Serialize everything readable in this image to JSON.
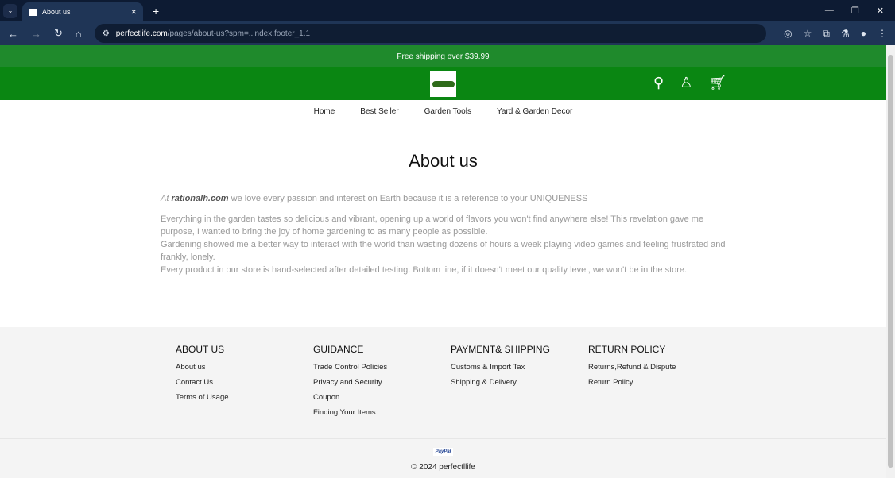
{
  "browser": {
    "tab_title": "About us",
    "url_domain": "perfectlife.com",
    "url_path": "/pages/about-us?spm=..index.footer_1.1"
  },
  "promo": "Free shipping over $39.99",
  "nav": [
    "Home",
    "Best Seller",
    "Garden Tools",
    "Yard & Garden Decor"
  ],
  "title": "About us",
  "intro": {
    "at": "At",
    "brand": "rationalh.com",
    "rest": " we love every passion and interest on Earth because it is a reference to your UNIQUENESS"
  },
  "paragraph": [
    "Everything in the garden tastes so delicious and vibrant, opening up a world of flavors you won't find anywhere else! This revelation gave me purpose, I wanted to bring the joy of home gardening to as many people as possible.",
    "Gardening showed me a better way to interact with the world than wasting dozens of hours a week playing video games and feeling frustrated and frankly, lonely.",
    "Every product in our store is hand-selected after detailed testing. Bottom line, if it doesn't meet our quality level, we won't be in the store."
  ],
  "footer": {
    "columns": [
      {
        "title": "ABOUT US",
        "links": [
          "About us",
          "Contact Us",
          "Terms of Usage"
        ]
      },
      {
        "title": "GUIDANCE",
        "links": [
          "Trade Control Policies",
          "Privacy and Security",
          "Coupon",
          "Finding Your Items"
        ]
      },
      {
        "title": "PAYMENT& SHIPPING",
        "links": [
          "Customs & Import Tax",
          "Shipping & Delivery"
        ]
      },
      {
        "title": "RETURN POLICY",
        "links": [
          "Returns,Refund & Dispute",
          "Return Policy"
        ]
      }
    ],
    "payment": "PayPal",
    "copyright": "© 2024 perfectllife"
  }
}
